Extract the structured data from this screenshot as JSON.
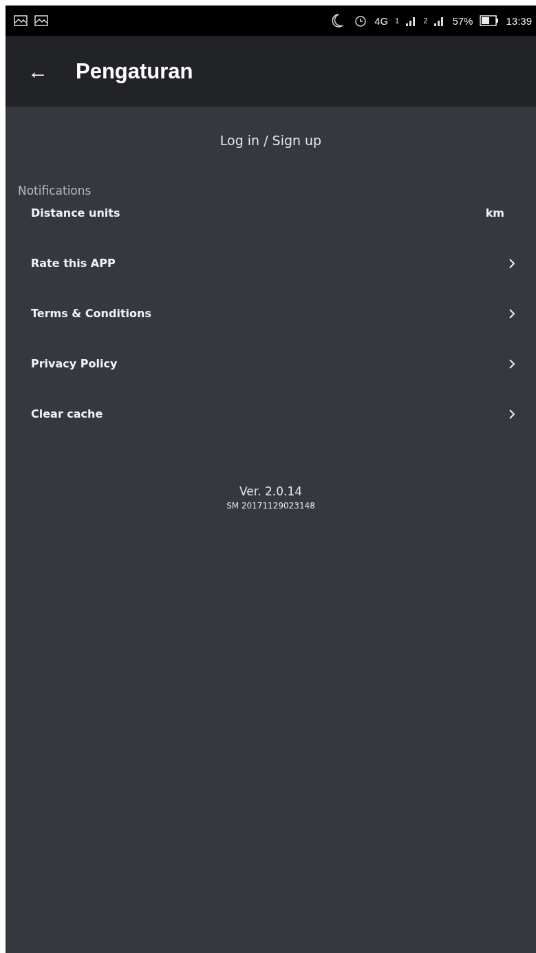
{
  "status_bar": {
    "network": "4G",
    "sim_1": "1",
    "sim_2": "2",
    "battery": "57%",
    "time": "13:39"
  },
  "app_bar": {
    "back": "←",
    "title": "Pengaturan"
  },
  "login": "Log in / Sign up",
  "section": "Notifications",
  "items": [
    {
      "kind": "value",
      "label": "Distance units",
      "value": "km"
    },
    {
      "kind": "link",
      "label": "Rate this APP"
    },
    {
      "kind": "link",
      "label": "Terms & Conditions"
    },
    {
      "kind": "link",
      "label": "Privacy Policy"
    },
    {
      "kind": "link",
      "label": "Clear cache"
    }
  ],
  "version": "Ver. 2.0.14",
  "build": "SM 20171129023148"
}
